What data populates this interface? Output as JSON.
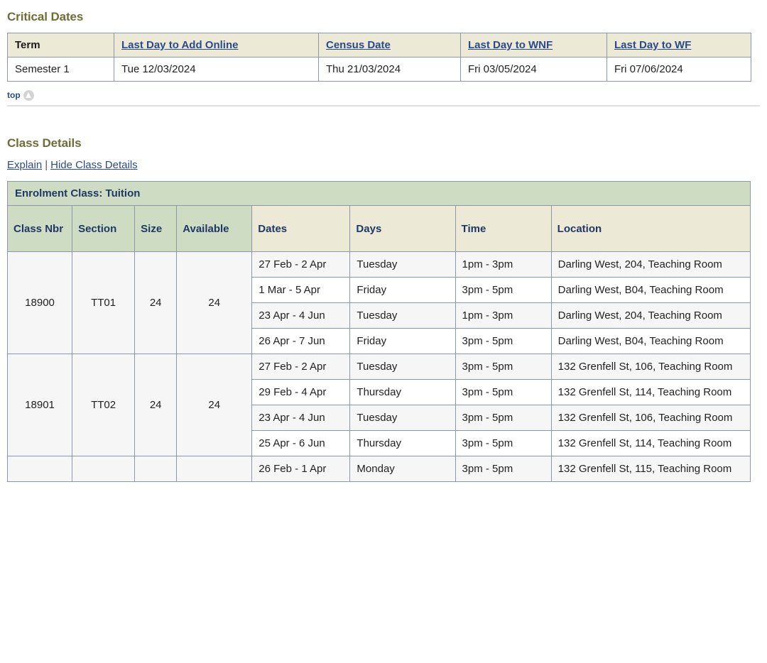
{
  "critical_dates": {
    "heading": "Critical Dates",
    "columns": [
      {
        "label": "Term",
        "is_link": false
      },
      {
        "label": "Last Day to Add Online",
        "is_link": true
      },
      {
        "label": "Census Date",
        "is_link": true
      },
      {
        "label": "Last Day to WNF",
        "is_link": true
      },
      {
        "label": "Last Day to WF",
        "is_link": true
      }
    ],
    "rows": [
      [
        "Semester 1",
        "Tue 12/03/2024",
        "Thu 21/03/2024",
        "Fri 03/05/2024",
        "Fri 07/06/2024"
      ]
    ]
  },
  "top_link": {
    "label": "top",
    "icon": "up-arrow-circle-icon"
  },
  "class_details": {
    "heading": "Class Details",
    "links": {
      "explain": "Explain",
      "separator": "|",
      "hide": "Hide Class Details"
    },
    "banner": "Enrolment Class: Tuition",
    "columns": [
      {
        "label": "Class Nbr",
        "tone": "green"
      },
      {
        "label": "Section",
        "tone": "green"
      },
      {
        "label": "Size",
        "tone": "green"
      },
      {
        "label": "Available",
        "tone": "green"
      },
      {
        "label": "Dates",
        "tone": "cream"
      },
      {
        "label": "Days",
        "tone": "cream"
      },
      {
        "label": "Time",
        "tone": "cream"
      },
      {
        "label": "Location",
        "tone": "cream"
      }
    ],
    "classes": [
      {
        "class_nbr": "18900",
        "section": "TT01",
        "size": "24",
        "available": "24",
        "meetings": [
          {
            "dates": "27 Feb - 2 Apr",
            "days": "Tuesday",
            "time": "1pm - 3pm",
            "location": "Darling West, 204, Teaching Room"
          },
          {
            "dates": "1 Mar - 5 Apr",
            "days": "Friday",
            "time": "3pm - 5pm",
            "location": "Darling West, B04, Teaching Room"
          },
          {
            "dates": "23 Apr - 4 Jun",
            "days": "Tuesday",
            "time": "1pm - 3pm",
            "location": "Darling West, 204, Teaching Room"
          },
          {
            "dates": "26 Apr - 7 Jun",
            "days": "Friday",
            "time": "3pm - 5pm",
            "location": "Darling West, B04, Teaching Room"
          }
        ]
      },
      {
        "class_nbr": "18901",
        "section": "TT02",
        "size": "24",
        "available": "24",
        "meetings": [
          {
            "dates": "27 Feb - 2 Apr",
            "days": "Tuesday",
            "time": "3pm - 5pm",
            "location": "132 Grenfell St, 106, Teaching Room"
          },
          {
            "dates": "29 Feb - 4 Apr",
            "days": "Thursday",
            "time": "3pm - 5pm",
            "location": "132 Grenfell St, 114, Teaching Room"
          },
          {
            "dates": "23 Apr - 4 Jun",
            "days": "Tuesday",
            "time": "3pm - 5pm",
            "location": "132 Grenfell St, 106, Teaching Room"
          },
          {
            "dates": "25 Apr - 6 Jun",
            "days": "Thursday",
            "time": "3pm - 5pm",
            "location": "132 Grenfell St, 114, Teaching Room"
          }
        ]
      },
      {
        "class_nbr": "",
        "section": "",
        "size": "",
        "available": "",
        "meetings": [
          {
            "dates": "26 Feb - 1 Apr",
            "days": "Monday",
            "time": "3pm - 5pm",
            "location": "132 Grenfell St, 115, Teaching Room"
          }
        ]
      }
    ]
  }
}
